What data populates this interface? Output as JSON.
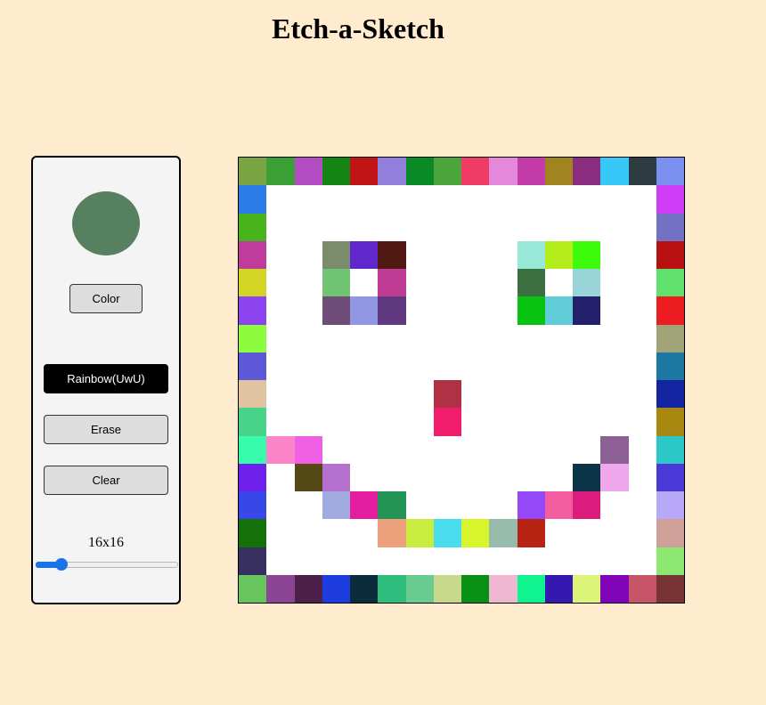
{
  "title": "Etch-a-Sketch",
  "colors": {
    "background": "#ffebcd",
    "current_color": "#568060"
  },
  "controls": {
    "color_label": "Color",
    "rainbow_label": "Rainbow(UwU)",
    "erase_label": "Erase",
    "clear_label": "Clear",
    "active_mode": "rainbow"
  },
  "grid_size": {
    "label": "16x16",
    "value": 16,
    "min": 1,
    "max": 100
  },
  "grid": {
    "rows": 16,
    "cols": 16,
    "cells": [
      [
        "#7aa444",
        "#3aa036",
        "#b44cc4",
        "#148414",
        "#c21414",
        "#9080dc",
        "#0a8a24",
        "#4ca43a",
        "#f03c64",
        "#e488dc",
        "#c43ca8",
        "#a08420",
        "#8a2c80",
        "#38c8f8",
        "#2c3c40",
        "#7c90f0"
      ],
      [
        "#2c7ce8",
        "#ffffff",
        "#ffffff",
        "#ffffff",
        "#ffffff",
        "#ffffff",
        "#ffffff",
        "#ffffff",
        "#ffffff",
        "#ffffff",
        "#ffffff",
        "#ffffff",
        "#ffffff",
        "#ffffff",
        "#ffffff",
        "#d03cf8"
      ],
      [
        "#48b41c",
        "#ffffff",
        "#ffffff",
        "#ffffff",
        "#ffffff",
        "#ffffff",
        "#ffffff",
        "#ffffff",
        "#ffffff",
        "#ffffff",
        "#ffffff",
        "#ffffff",
        "#ffffff",
        "#ffffff",
        "#ffffff",
        "#7470c4"
      ],
      [
        "#c03c9c",
        "#ffffff",
        "#ffffff",
        "#7a8c6c",
        "#6028cc",
        "#501810",
        "#ffffff",
        "#ffffff",
        "#ffffff",
        "#ffffff",
        "#98e8d8",
        "#b4ec1c",
        "#3cfc0c",
        "#ffffff",
        "#ffffff",
        "#b81010"
      ],
      [
        "#d4d424",
        "#ffffff",
        "#ffffff",
        "#70c474",
        "#ffffff",
        "#c03c94",
        "#ffffff",
        "#ffffff",
        "#ffffff",
        "#ffffff",
        "#3c7040",
        "#ffffff",
        "#98d4d8",
        "#ffffff",
        "#ffffff",
        "#60e06c"
      ],
      [
        "#8c44f0",
        "#ffffff",
        "#ffffff",
        "#704c78",
        "#9098e4",
        "#603880",
        "#ffffff",
        "#ffffff",
        "#ffffff",
        "#ffffff",
        "#08c410",
        "#60ccd8",
        "#24206c",
        "#ffffff",
        "#ffffff",
        "#ec1c20"
      ],
      [
        "#8cfc3c",
        "#ffffff",
        "#ffffff",
        "#ffffff",
        "#ffffff",
        "#ffffff",
        "#ffffff",
        "#ffffff",
        "#ffffff",
        "#ffffff",
        "#ffffff",
        "#ffffff",
        "#ffffff",
        "#ffffff",
        "#ffffff",
        "#a0a478"
      ],
      [
        "#5c58d8",
        "#ffffff",
        "#ffffff",
        "#ffffff",
        "#ffffff",
        "#ffffff",
        "#ffffff",
        "#ffffff",
        "#ffffff",
        "#ffffff",
        "#ffffff",
        "#ffffff",
        "#ffffff",
        "#ffffff",
        "#ffffff",
        "#1c78a0"
      ],
      [
        "#e0c4a0",
        "#ffffff",
        "#ffffff",
        "#ffffff",
        "#ffffff",
        "#ffffff",
        "#ffffff",
        "#b03044",
        "#ffffff",
        "#ffffff",
        "#ffffff",
        "#ffffff",
        "#ffffff",
        "#ffffff",
        "#ffffff",
        "#1424a0"
      ],
      [
        "#48d488",
        "#ffffff",
        "#ffffff",
        "#ffffff",
        "#ffffff",
        "#ffffff",
        "#ffffff",
        "#f01c6c",
        "#ffffff",
        "#ffffff",
        "#ffffff",
        "#ffffff",
        "#ffffff",
        "#ffffff",
        "#ffffff",
        "#a88810"
      ],
      [
        "#38fcac",
        "#fc84c8",
        "#f060e4",
        "#ffffff",
        "#ffffff",
        "#ffffff",
        "#ffffff",
        "#ffffff",
        "#ffffff",
        "#ffffff",
        "#ffffff",
        "#ffffff",
        "#ffffff",
        "#8c6094",
        "#ffffff",
        "#2cc8c8"
      ],
      [
        "#7020ec",
        "#ffffff",
        "#544814",
        "#b470cc",
        "#ffffff",
        "#ffffff",
        "#ffffff",
        "#ffffff",
        "#ffffff",
        "#ffffff",
        "#ffffff",
        "#ffffff",
        "#0c3448",
        "#f0a8ec",
        "#ffffff",
        "#4c38d8"
      ],
      [
        "#3848e8",
        "#ffffff",
        "#ffffff",
        "#a0ace0",
        "#e41ca0",
        "#249454",
        "#ffffff",
        "#ffffff",
        "#ffffff",
        "#ffffff",
        "#9448f8",
        "#f45ca0",
        "#dc1c7c",
        "#ffffff",
        "#ffffff",
        "#b8a8f8"
      ],
      [
        "#147008",
        "#ffffff",
        "#ffffff",
        "#ffffff",
        "#ffffff",
        "#eca07c",
        "#c8ec40",
        "#48dcec",
        "#d8f42c",
        "#98bcac",
        "#b82414",
        "#ffffff",
        "#ffffff",
        "#ffffff",
        "#ffffff",
        "#d0a098"
      ],
      [
        "#383060",
        "#ffffff",
        "#ffffff",
        "#ffffff",
        "#ffffff",
        "#ffffff",
        "#ffffff",
        "#ffffff",
        "#ffffff",
        "#ffffff",
        "#ffffff",
        "#ffffff",
        "#ffffff",
        "#ffffff",
        "#ffffff",
        "#8ce870"
      ],
      [
        "#68c45c",
        "#8c4494",
        "#4c2048",
        "#1c3ce0",
        "#0c2c3c",
        "#30bc7c",
        "#68cc90",
        "#c8d88c",
        "#089014",
        "#f0b8d0",
        "#10f490",
        "#3418b0",
        "#dcf478",
        "#8004b8",
        "#c85468",
        "#783434"
      ]
    ]
  }
}
